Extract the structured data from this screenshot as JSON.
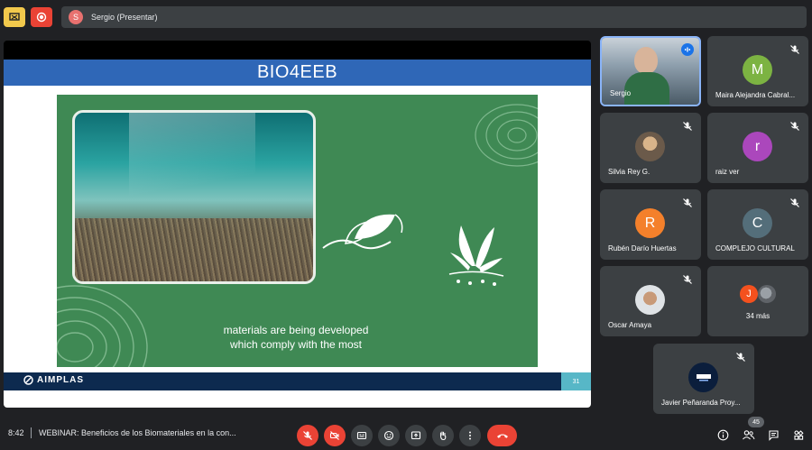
{
  "presenter": {
    "avatar_letter": "S",
    "label": "Sergio (Presentar)"
  },
  "slide": {
    "title": "BIO4EEB",
    "caption_line1": "materials are being developed",
    "caption_line2": "which comply with the most",
    "footer_brand": "AIMPLAS",
    "page_number": "31"
  },
  "participants": [
    {
      "name": "Sergio",
      "type": "video"
    },
    {
      "name": "Maira Alejandra Cabral...",
      "letter": "M",
      "color": "#7cb342"
    },
    {
      "name": "Silvia Rey G.",
      "type": "video"
    },
    {
      "name": "raiz ver",
      "letter": "r",
      "color": "#ab47bc"
    },
    {
      "name": "Rubén Darío Huertas",
      "letter": "R",
      "color": "#f4802b"
    },
    {
      "name": "COMPLEJO CULTURAL",
      "letter": "C",
      "color": "#546e7a"
    },
    {
      "name": "Oscar Amaya",
      "type": "video"
    },
    {
      "name": "34 más",
      "letter": "J",
      "color": "#f4511e"
    },
    {
      "name": "Javier Peñaranda Proy...",
      "type": "video"
    }
  ],
  "bottombar": {
    "time": "8:42",
    "meeting_title": "WEBINAR: Beneficios de los Biomateriales en la con...",
    "participant_count": "45"
  },
  "icons": {
    "mic_off": "mic-off-icon",
    "cam_off": "camera-off-icon",
    "captions": "captions-icon",
    "emoji": "emoji-icon",
    "present": "present-icon",
    "hand": "raise-hand-icon",
    "more": "more-options-icon",
    "end": "end-call-icon"
  }
}
